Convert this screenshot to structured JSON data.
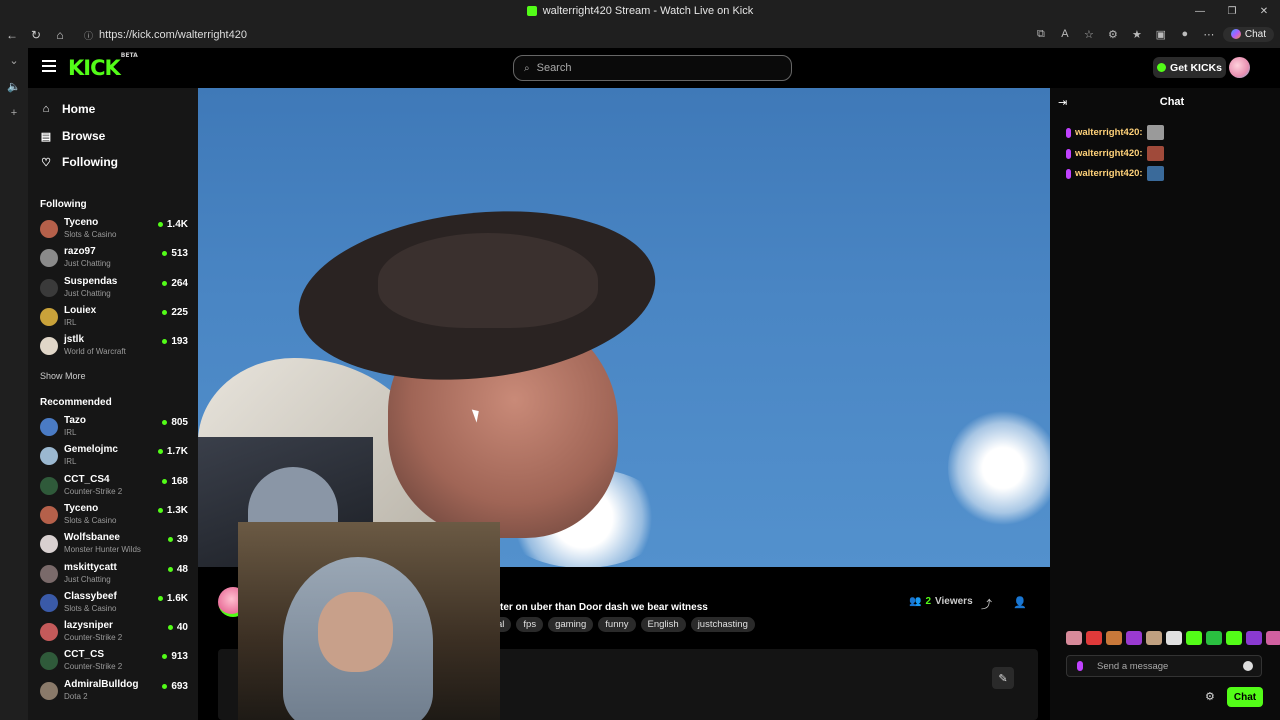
{
  "browser": {
    "window_title": "walterright420 Stream - Watch Live on Kick",
    "url": "https://kick.com/walterright420",
    "copilot_label": "Chat"
  },
  "header": {
    "logo": "KICK",
    "logo_badge": "BETA",
    "search_placeholder": "Search",
    "get_kicks_label": "Get KICKs"
  },
  "sidebar": {
    "nav": [
      {
        "label": "Home",
        "icon": "home-icon"
      },
      {
        "label": "Browse",
        "icon": "browse-icon"
      },
      {
        "label": "Following",
        "icon": "heart-icon"
      }
    ],
    "following_title": "Following",
    "following": [
      {
        "name": "Tyceno",
        "category": "Slots & Casino",
        "viewers": "1.4K",
        "color": "#b5604a"
      },
      {
        "name": "razo97",
        "category": "Just Chatting",
        "viewers": "513",
        "color": "#8a8a8a"
      },
      {
        "name": "Suspendas",
        "category": "Just Chatting",
        "viewers": "264",
        "color": "#3a3a3a"
      },
      {
        "name": "Louiex",
        "category": "IRL",
        "viewers": "225",
        "color": "#c9a23a"
      },
      {
        "name": "jstlk",
        "category": "World of Warcraft",
        "viewers": "193",
        "color": "#e0d6c8"
      }
    ],
    "show_more": "Show More",
    "recommended_title": "Recommended",
    "recommended": [
      {
        "name": "Tazo",
        "category": "IRL",
        "viewers": "805",
        "color": "#4a7bc4"
      },
      {
        "name": "Gemelojmc",
        "category": "IRL",
        "viewers": "1.7K",
        "color": "#9bb8d0"
      },
      {
        "name": "CCT_CS4",
        "category": "Counter-Strike 2",
        "viewers": "168",
        "color": "#2f5a3a"
      },
      {
        "name": "Tyceno",
        "category": "Slots & Casino",
        "viewers": "1.3K",
        "color": "#b5604a"
      },
      {
        "name": "Wolfsbanee",
        "category": "Monster Hunter Wilds",
        "viewers": "39",
        "color": "#d8d0d0"
      },
      {
        "name": "mskittycatt",
        "category": "Just Chatting",
        "viewers": "48",
        "color": "#7a6a6a"
      },
      {
        "name": "Classybeef",
        "category": "Slots & Casino",
        "viewers": "1.6K",
        "color": "#3a5aa8"
      },
      {
        "name": "lazysniper",
        "category": "Counter-Strike 2",
        "viewers": "40",
        "color": "#c45a5a"
      },
      {
        "name": "CCT_CS",
        "category": "Counter-Strike 2",
        "viewers": "913",
        "color": "#2f5a3a"
      },
      {
        "name": "AdmiralBulldog",
        "category": "Dota 2",
        "viewers": "693",
        "color": "#8a7a6a"
      }
    ]
  },
  "stream": {
    "title_fragment": "ter on uber than Door dash we bear witness",
    "tags": [
      "al",
      "fps",
      "gaming",
      "funny",
      "English",
      "justchasting"
    ],
    "viewers_count": "2",
    "viewers_label": "Viewers"
  },
  "chat": {
    "title": "Chat",
    "messages": [
      {
        "user": "walterright420:",
        "emote_color": "#9a9a9a"
      },
      {
        "user": "walterright420:",
        "emote_color": "#a04a3a"
      },
      {
        "user": "walterright420:",
        "emote_color": "#3a6a9a"
      }
    ],
    "emote_bar_colors": [
      "#d88a9a",
      "#e03a3a",
      "#c8783a",
      "#9a3ad0",
      "#c0a080",
      "#e0e0e0",
      "#53fc18",
      "#2ac040",
      "#53fc18",
      "#8a3ad0",
      "#d060a0"
    ],
    "input_placeholder": "Send a message",
    "send_label": "Chat"
  }
}
